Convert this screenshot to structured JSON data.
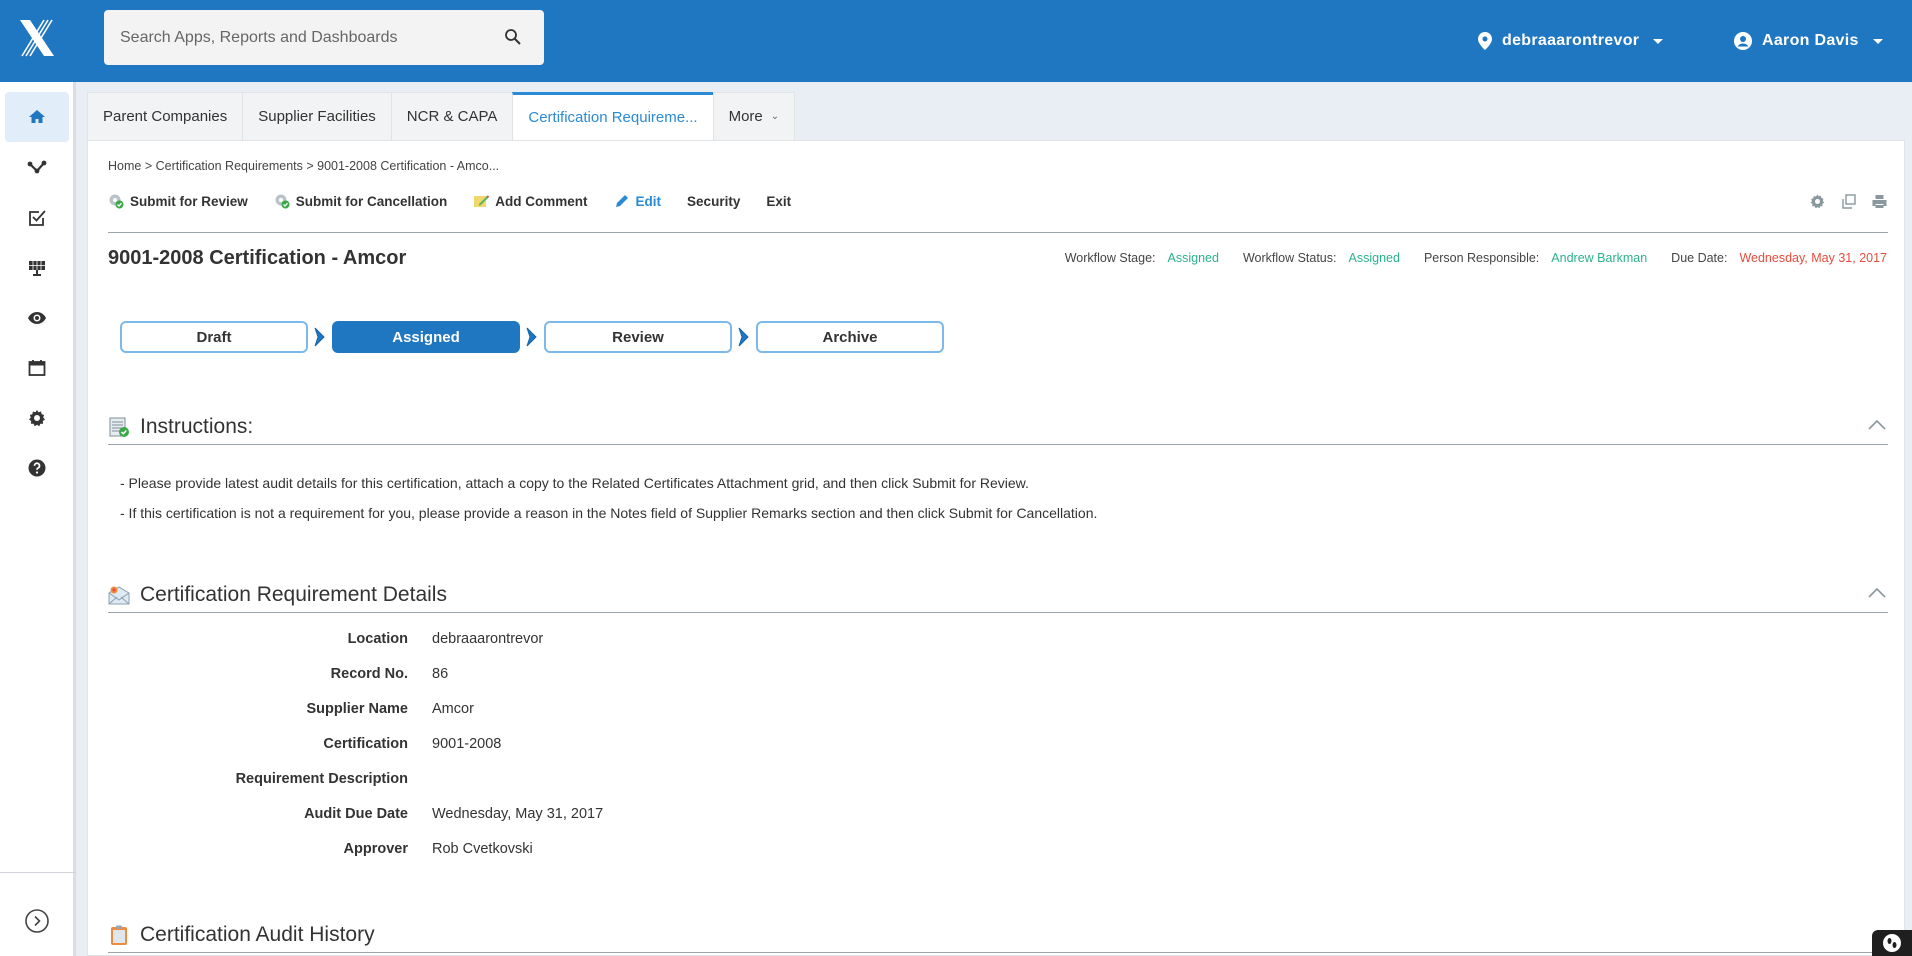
{
  "topbar": {
    "search_placeholder": "Search Apps, Reports and Dashboards",
    "location": "debraaarontrevor",
    "user": "Aaron Davis",
    "brand_color": "#1f76c1"
  },
  "sidebar": {
    "items": [
      {
        "icon": "home-icon",
        "active": true
      },
      {
        "icon": "workflow-icon"
      },
      {
        "icon": "checkbox-icon"
      },
      {
        "icon": "solar-panel-icon"
      },
      {
        "icon": "eye-icon"
      },
      {
        "icon": "calendar-icon"
      },
      {
        "icon": "gear-icon"
      },
      {
        "icon": "help-icon"
      }
    ],
    "expand_icon": "chevron-right-circle-icon"
  },
  "tabs": [
    {
      "label": "Parent Companies"
    },
    {
      "label": "Supplier Facilities"
    },
    {
      "label": "NCR & CAPA"
    },
    {
      "label": "Certification Requireme...",
      "active": true
    },
    {
      "label": "More"
    }
  ],
  "breadcrumb": "Home > Certification Requirements > 9001-2008 Certification - Amco...",
  "toolbar": {
    "submit_review": "Submit for Review",
    "submit_cancel": "Submit for Cancellation",
    "add_comment": "Add Comment",
    "edit": "Edit",
    "security": "Security",
    "exit": "Exit"
  },
  "record": {
    "title": "9001-2008 Certification - Amcor",
    "meta": {
      "stage_label": "Workflow Stage:",
      "stage_value": "Assigned",
      "status_label": "Workflow Status:",
      "status_value": "Assigned",
      "person_label": "Person Responsible:",
      "person_value": "Andrew Barkman",
      "due_label": "Due Date:",
      "due_value": "Wednesday, May 31, 2017"
    }
  },
  "stages": [
    {
      "label": "Draft"
    },
    {
      "label": "Assigned",
      "current": true
    },
    {
      "label": "Review"
    },
    {
      "label": "Archive"
    }
  ],
  "instructions": {
    "title": "Instructions:",
    "lines": [
      "- Please provide latest audit details for this certification, attach a copy to the Related Certificates Attachment grid, and then click Submit for Review.",
      "- If this certification is not a requirement for you, please provide a reason in the Notes field of Supplier Remarks section and then click Submit for Cancellation."
    ]
  },
  "details": {
    "title": "Certification Requirement Details",
    "fields": [
      {
        "label": "Location",
        "value": "debraaarontrevor"
      },
      {
        "label": "Record No.",
        "value": "86"
      },
      {
        "label": "Supplier Name",
        "value": "Amcor"
      },
      {
        "label": "Certification",
        "value": "9001-2008"
      },
      {
        "label": "Requirement Description",
        "value": ""
      },
      {
        "label": "Audit Due Date",
        "value": "Wednesday, May 31, 2017"
      },
      {
        "label": "Approver",
        "value": "Rob Cvetkovski"
      }
    ]
  },
  "audit_history": {
    "title": "Certification Audit History"
  },
  "colors": {
    "accent": "#2a8ad4",
    "status_green": "#2bb28d",
    "due_red": "#e74c3c"
  }
}
